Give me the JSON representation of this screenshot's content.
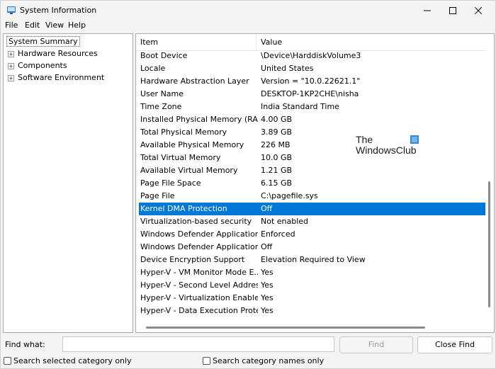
{
  "window": {
    "title": "System Information"
  },
  "menu": {
    "file": "File",
    "edit": "Edit",
    "view": "View",
    "help": "Help"
  },
  "tree": {
    "root": "System Summary",
    "children": [
      "Hardware Resources",
      "Components",
      "Software Environment"
    ]
  },
  "table": {
    "headers": {
      "item": "Item",
      "value": "Value"
    },
    "rows": [
      {
        "item": "Boot Device",
        "value": "\\Device\\HarddiskVolume3"
      },
      {
        "item": "Locale",
        "value": "United States"
      },
      {
        "item": "Hardware Abstraction Layer",
        "value": "Version = \"10.0.22621.1\""
      },
      {
        "item": "User Name",
        "value": "DESKTOP-1KP2CHE\\nisha"
      },
      {
        "item": "Time Zone",
        "value": "India Standard Time"
      },
      {
        "item": "Installed Physical Memory (RAM)",
        "value": "4.00 GB"
      },
      {
        "item": "Total Physical Memory",
        "value": "3.89 GB"
      },
      {
        "item": "Available Physical Memory",
        "value": "226 MB"
      },
      {
        "item": "Total Virtual Memory",
        "value": "10.0 GB"
      },
      {
        "item": "Available Virtual Memory",
        "value": "1.21 GB"
      },
      {
        "item": "Page File Space",
        "value": "6.15 GB"
      },
      {
        "item": "Page File",
        "value": "C:\\pagefile.sys"
      },
      {
        "item": "Kernel DMA Protection",
        "value": "Off"
      },
      {
        "item": "Virtualization-based security",
        "value": "Not enabled"
      },
      {
        "item": "Windows Defender Application...",
        "value": "Enforced"
      },
      {
        "item": "Windows Defender Application...",
        "value": "Off"
      },
      {
        "item": "Device Encryption Support",
        "value": "Elevation Required to View"
      },
      {
        "item": "Hyper-V - VM Monitor Mode E...",
        "value": "Yes"
      },
      {
        "item": "Hyper-V - Second Level Addres...",
        "value": "Yes"
      },
      {
        "item": "Hyper-V - Virtualization Enable...",
        "value": "Yes"
      },
      {
        "item": "Hyper-V - Data Execution Prote...",
        "value": "Yes"
      }
    ],
    "selected_row_index": 12
  },
  "watermark": {
    "line1": "The",
    "line2": "WindowsClub"
  },
  "find": {
    "label": "Find what:",
    "value": "",
    "find_button": "Find",
    "close_button": "Close Find",
    "search_selected": "Search selected category only",
    "search_names": "Search category names only"
  },
  "colors": {
    "selection": "#0078d7",
    "watermark_accent": "#2e8bd8"
  }
}
